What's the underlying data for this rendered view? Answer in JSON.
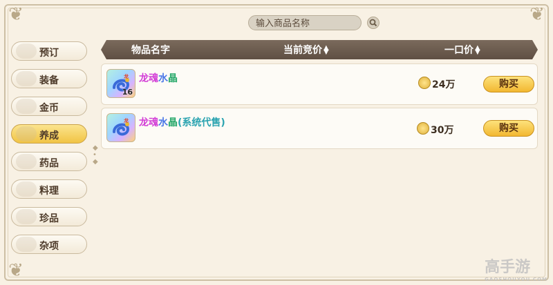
{
  "search": {
    "placeholder": "输入商品名称"
  },
  "sidebar": {
    "items": [
      {
        "label": "预订",
        "active": false
      },
      {
        "label": "装备",
        "active": false
      },
      {
        "label": "金币",
        "active": false
      },
      {
        "label": "养成",
        "active": true
      },
      {
        "label": "药品",
        "active": false
      },
      {
        "label": "料理",
        "active": false
      },
      {
        "label": "珍品",
        "active": false
      },
      {
        "label": "杂项",
        "active": false
      }
    ]
  },
  "table": {
    "headers": {
      "name": "物品名字",
      "bid": "当前竞价",
      "buyout": "一口价"
    },
    "rows": [
      {
        "name_parts": [
          "龙魂",
          "水",
          "晶"
        ],
        "quantity": "16",
        "price": "24万",
        "buy_label": "购买"
      },
      {
        "name_parts": [
          "龙魂",
          "水",
          "晶",
          "(系统代售)"
        ],
        "quantity": "",
        "price": "30万",
        "buy_label": "购买"
      }
    ]
  },
  "colors": {
    "name_gradient": [
      "#d23cd6",
      "#5a64f0",
      "#27b06a",
      "#2ab3a8"
    ],
    "active_tab": "#f1c444",
    "header_bar": "#6a594c"
  },
  "watermark": {
    "logo": "高手游",
    "sub": "GAOSHOUYOU.COM"
  }
}
